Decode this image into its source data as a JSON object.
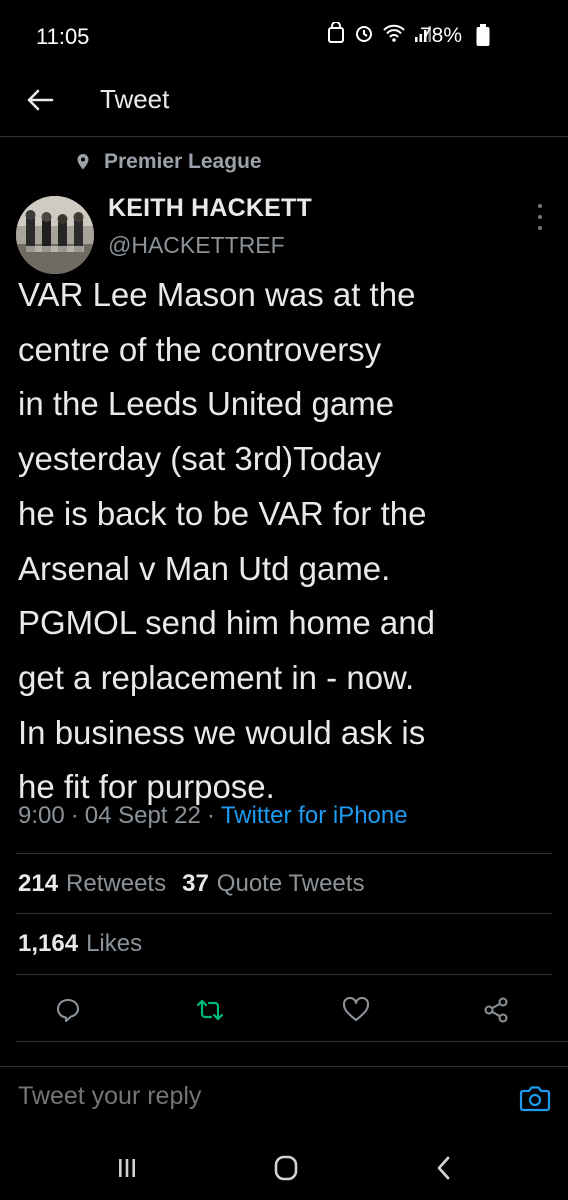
{
  "status_bar": {
    "time": "11:05",
    "battery": "78%"
  },
  "header": {
    "title": "Tweet"
  },
  "tweet": {
    "context_label": "Premier League",
    "display_name": "KEITH HACKETT",
    "handle": "@HACKETTREF",
    "text": "VAR Lee Mason was at the\ncentre of the controversy\nin the Leeds United game\nyesterday (sat 3rd)Today\nhe is back to be VAR for the\nArsenal v Man Utd game.\nPGMOL  send him home and\nget a replacement in - now.\nIn business we would ask is\nhe fit for purpose.",
    "time": "9:00",
    "date": "04 Sept 22",
    "separator": "·",
    "source": "Twitter for iPhone",
    "retweets_count": "214",
    "retweets_label": "Retweets",
    "quotes_count": "37",
    "quotes_label": "Quote Tweets",
    "likes_count": "1,164",
    "likes_label": "Likes"
  },
  "reply": {
    "placeholder": "Tweet your reply"
  },
  "icons": {
    "back": "arrow-left-icon",
    "context": "location-pin-icon",
    "more": "more-vertical-icon",
    "reply": "reply-icon",
    "retweet": "retweet-icon",
    "like": "heart-icon",
    "share": "share-icon",
    "camera": "camera-icon"
  },
  "colors": {
    "background": "#000000",
    "accent": "#1d9bf0",
    "retweet_green": "#00ba7c",
    "secondary_text": "#8b9298"
  }
}
